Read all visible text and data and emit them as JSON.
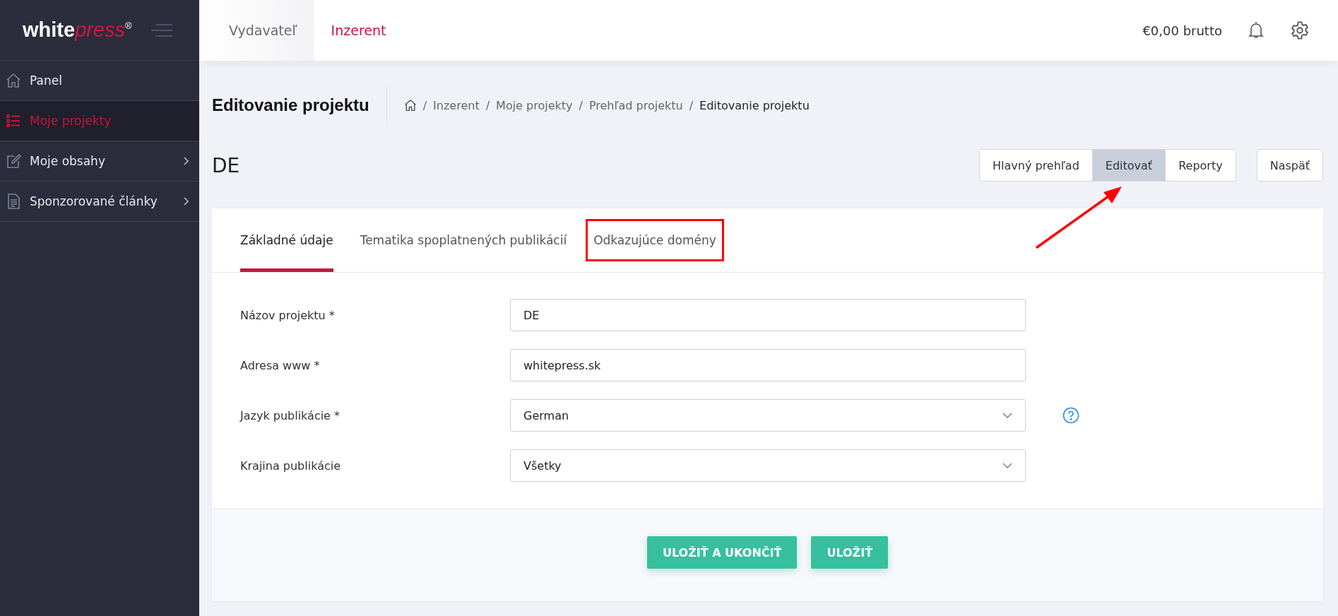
{
  "logo": {
    "bold": "white",
    "italic": "press",
    "mark": "®"
  },
  "top_tabs": [
    {
      "label": "Vydavateľ",
      "selected": false
    },
    {
      "label": "Inzerent",
      "selected": true
    }
  ],
  "balance": "€0,00 brutto",
  "sidebar": {
    "items": [
      {
        "label": "Panel",
        "selected": false,
        "has_submenu": false
      },
      {
        "label": "Moje projekty",
        "selected": true,
        "has_submenu": false
      },
      {
        "label": "Moje obsahy",
        "selected": false,
        "has_submenu": true
      },
      {
        "label": "Sponzorované články",
        "selected": false,
        "has_submenu": true
      }
    ]
  },
  "page_title": "Editovanie projektu",
  "breadcrumbs": [
    {
      "sep": "/",
      "label": "Inzerent",
      "current": false
    },
    {
      "sep": "/",
      "label": "Moje projekty",
      "current": false
    },
    {
      "sep": "/",
      "label": "Prehľad projektu",
      "current": false
    },
    {
      "sep": "/",
      "label": "Editovanie projektu",
      "current": true
    }
  ],
  "project_name": "DE",
  "view_buttons": [
    {
      "label": "Hlavný prehľad",
      "selected": false
    },
    {
      "label": "Editovať",
      "selected": true
    },
    {
      "label": "Reporty",
      "selected": false
    }
  ],
  "back_button": "Naspäť",
  "form_tabs": [
    {
      "label": "Základné údaje",
      "selected": true,
      "highlighted": false
    },
    {
      "label": "Tematika spoplatnených publikácií",
      "selected": false,
      "highlighted": false
    },
    {
      "label": "Odkazujúce domény",
      "selected": false,
      "highlighted": true
    }
  ],
  "fields": [
    {
      "kind": "text",
      "label": "Názov projektu *",
      "value": "DE",
      "help": false
    },
    {
      "kind": "text",
      "label": "Adresa www *",
      "value": "whitepress.sk",
      "help": false
    },
    {
      "kind": "select",
      "label": "Jazyk publikácie *",
      "value": "German",
      "help": true
    },
    {
      "kind": "select",
      "label": "Krajina publikácie",
      "value": "Všetky",
      "help": false
    }
  ],
  "buttons": [
    "ULOŽIŤ A UKONČIŤ",
    "ULOŽIŤ"
  ]
}
